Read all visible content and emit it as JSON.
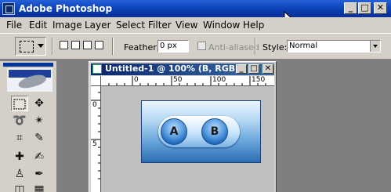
{
  "app": {
    "title": "Adobe Photoshop"
  },
  "window_controls": {
    "minimize": "_",
    "maximize": "□",
    "close": "✕"
  },
  "menu": [
    "File",
    "Edit",
    "Image",
    "Layer",
    "Select",
    "Filter",
    "View",
    "Window",
    "Help"
  ],
  "options": {
    "feather_label": "Feather:",
    "feather_value": "0 px",
    "antialias_label": "Anti-aliased",
    "style_label": "Style:",
    "style_value": "Normal"
  },
  "document": {
    "title": "Untitled-1 @ 100% (B, RGB...",
    "ruler_h": [
      "0",
      "50",
      "100",
      "150"
    ],
    "ruler_v": [
      "0",
      "5"
    ],
    "buttons": {
      "a": "A",
      "b": "B"
    }
  },
  "colors": {
    "titlebar": "#0a3fb3",
    "chrome": "#d4d0c8",
    "workspace": "#7f7f82",
    "doc_titlebar": "#0a246a"
  },
  "icons": [
    "photoshop-icon",
    "marquee-icon",
    "move-icon",
    "lasso-icon",
    "magic-wand-icon",
    "crop-icon",
    "slice-icon",
    "healing-brush-icon",
    "brush-icon",
    "stamp-icon",
    "history-brush-icon",
    "mouse-pointer-icon"
  ]
}
